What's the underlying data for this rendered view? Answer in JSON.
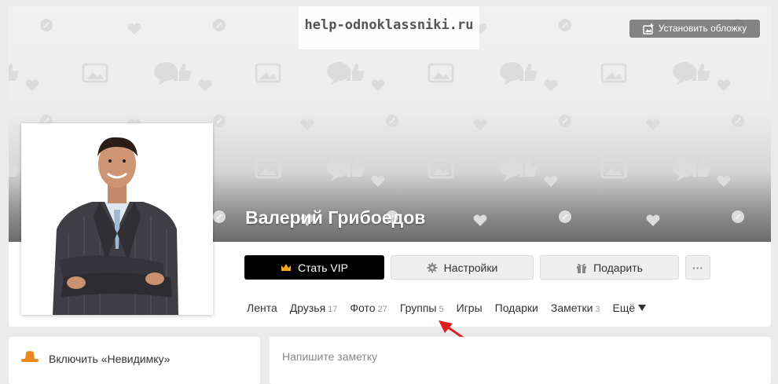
{
  "watermark": "help-odnoklassniki.ru",
  "cover": {
    "button_label": "Установить обложку",
    "button_icon": "add-image-icon"
  },
  "profile": {
    "name": "Валерий Грибоедов"
  },
  "actions": {
    "vip": {
      "label": "Стать VIP",
      "icon": "crown-icon",
      "icon_color": "#f5a623"
    },
    "settings": {
      "label": "Настройки",
      "icon": "gear-icon"
    },
    "gift": {
      "label": "Подарить",
      "icon": "gift-icon"
    },
    "more": {
      "label": "···"
    }
  },
  "nav": [
    {
      "label": "Лента",
      "count": ""
    },
    {
      "label": "Друзья",
      "count": "17"
    },
    {
      "label": "Фото",
      "count": "27"
    },
    {
      "label": "Группы",
      "count": "5"
    },
    {
      "label": "Игры",
      "count": ""
    },
    {
      "label": "Подарки",
      "count": ""
    },
    {
      "label": "Заметки",
      "count": "3"
    },
    {
      "label": "Ещё",
      "count": ""
    }
  ],
  "sidebar": {
    "invisible_label": "Включить «Невидимку»",
    "icon_color": "#e8891f"
  },
  "note": {
    "placeholder": "Напишите заметку"
  },
  "colors": {
    "accent": "#ee8208",
    "arrow": "#e02020"
  }
}
